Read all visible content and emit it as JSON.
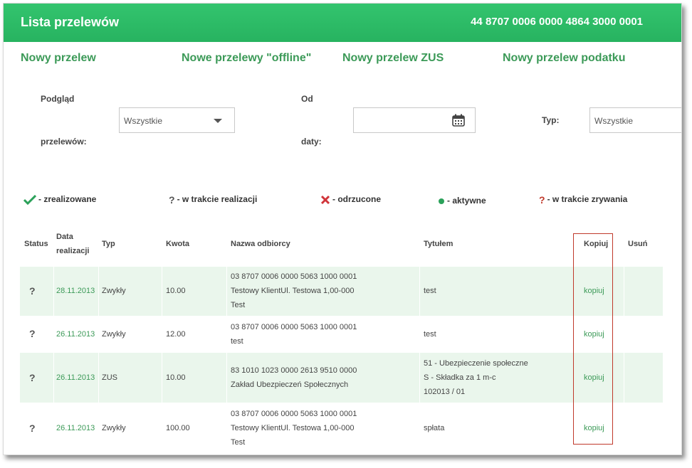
{
  "header": {
    "title": "Lista przelewów",
    "account": "44 8707 0006 0000 4864 3000 0001"
  },
  "actions": [
    {
      "label": "Nowy przelew"
    },
    {
      "label": "Nowe przelewy \"offline\""
    },
    {
      "label": "Nowy przelew ZUS"
    },
    {
      "label": "Nowy przelew podatku"
    }
  ],
  "filters": {
    "view_label_1": "Podgląd",
    "view_label_2": "przelewów:",
    "view_value": "Wszystkie",
    "from_label_1": "Od",
    "from_label_2": "daty:",
    "from_value": "",
    "type_label": "Typ:",
    "type_value": "Wszystkie"
  },
  "legend": {
    "done": "- zrealizowane",
    "pending": "- w trakcie realizacji",
    "rejected": "- odrzucone",
    "active": "- aktywne",
    "cancelling": "- w trakcie zrywania"
  },
  "colors": {
    "header_green": "#2cba66",
    "link_green": "#3c9a58",
    "row_green": "#eaf6ec",
    "highlight_red": "#c0392b"
  },
  "table": {
    "headers": {
      "status": "Status",
      "date_1": "Data",
      "date_2": "realizacji",
      "type": "Typ",
      "amount": "Kwota",
      "recipient": "Nazwa odbiorcy",
      "title": "Tytułem",
      "copy": "Kopiuj",
      "delete": "Usuń"
    },
    "rows": [
      {
        "status_icon": "?",
        "date": "28.11.2013",
        "type": "Zwykły",
        "amount": "10.00",
        "recipient": [
          "03 8707 0006 0000 5063 1000 0001",
          "Testowy KlientUl. Testowa 1,00-000",
          "Test"
        ],
        "title": [
          "test"
        ],
        "copy": "kopiuj"
      },
      {
        "status_icon": "?",
        "date": "26.11.2013",
        "type": "Zwykły",
        "amount": "12.00",
        "recipient": [
          "03 8707 0006 0000 5063 1000 0001",
          "test"
        ],
        "title": [
          "test"
        ],
        "copy": "kopiuj"
      },
      {
        "status_icon": "?",
        "date": "26.11.2013",
        "type": "ZUS",
        "amount": "10.00",
        "recipient": [
          "83 1010 1023 0000 2613 9510 0000",
          "Zakład Ubezpieczeń Społecznych"
        ],
        "title": [
          "51 - Ubezpieczenie społeczne",
          "S - Składka za 1 m-c",
          "102013 / 01"
        ],
        "copy": "kopiuj"
      },
      {
        "status_icon": "?",
        "date": "26.11.2013",
        "type": "Zwykły",
        "amount": "100.00",
        "recipient": [
          "03 8707 0006 0000 5063 1000 0001",
          "Testowy KlientUl. Testowa 1,00-000",
          "Test"
        ],
        "title": [
          "spłata"
        ],
        "copy": "kopiuj"
      }
    ]
  }
}
